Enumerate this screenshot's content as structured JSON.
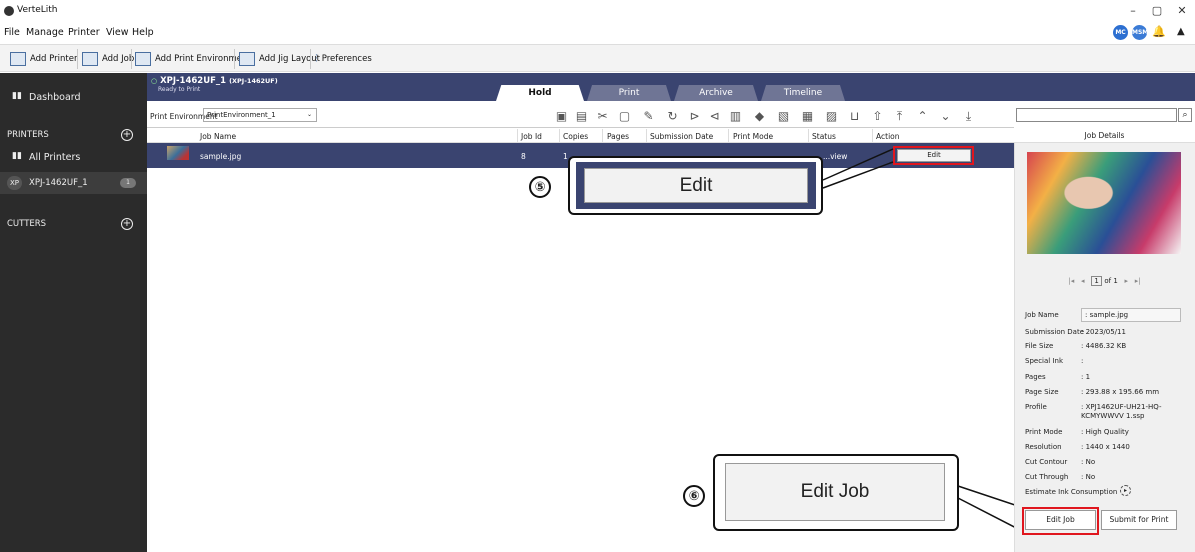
{
  "app": {
    "title": "VerteLith",
    "window_controls": [
      "–",
      "▢",
      "✕"
    ]
  },
  "menu": [
    "File",
    "Manage",
    "Printer",
    "View",
    "Help"
  ],
  "user_badges": [
    "MC",
    "MSM"
  ],
  "toolbar": {
    "add_printer": "Add Printer",
    "add_job": "Add Job",
    "add_print_env": "Add Print Environment",
    "add_jig": "Add Jig Layout",
    "preferences": "Preferences"
  },
  "sidebar": {
    "dashboard": "Dashboard",
    "printers_header": "PRINTERS",
    "all_printers": "All Printers",
    "printer_tag": "XP",
    "printer_item": "XPJ-1462UF_1",
    "printer_count": "1",
    "cutters_header": "CUTTERS"
  },
  "header": {
    "printer_name": "XPJ-1462UF_1",
    "printer_model": "(XPJ-1462UF)",
    "status": "Ready to Print",
    "tabs": [
      "Hold",
      "Print",
      "Archive",
      "Timeline"
    ],
    "active_tab": "Hold"
  },
  "env": {
    "label": "Print Environment",
    "value": "PrintEnvironment_1"
  },
  "columns": [
    "Job Name",
    "Job Id",
    "Copies",
    "Pages",
    "Submission Date",
    "Print Mode",
    "Status",
    "Action"
  ],
  "rows": [
    {
      "job_name": "sample.jpg",
      "job_id": "8",
      "copies": "1",
      "status_partial": "...view",
      "action": "Edit"
    }
  ],
  "callouts": {
    "step5": "⑤",
    "step5_label": "Edit",
    "step6": "⑥",
    "step6_label": "Edit Job"
  },
  "details": {
    "header": "Job Details",
    "pager": {
      "page": "1",
      "of": "of 1"
    },
    "fields": [
      {
        "label": "Job Name",
        "value": ": sample.jpg"
      },
      {
        "label": "Submission Date",
        "value": ": 2023/05/11"
      },
      {
        "label": "File Size",
        "value": ": 4486.32 KB"
      },
      {
        "label": "Special Ink",
        "value": ":"
      },
      {
        "label": "Pages",
        "value": ": 1"
      },
      {
        "label": "Page Size",
        "value": ": 293.88 x 195.66 mm"
      },
      {
        "label": "Profile",
        "value": ": XPJ1462UF-UH21-HQ-KCMYWWVV 1.ssp"
      },
      {
        "label": "Print Mode",
        "value": ": High Quality"
      },
      {
        "label": "Resolution",
        "value": ": 1440 x 1440"
      },
      {
        "label": "Cut Contour",
        "value": ": No"
      },
      {
        "label": "Cut Through",
        "value": ": No"
      }
    ],
    "estimate": "Estimate Ink Consumption",
    "edit_job": "Edit Job",
    "submit": "Submit for Print"
  },
  "colors": {
    "sidebar": "#2b2b2b",
    "header": "#3a4470",
    "highlight": "#e0161e"
  }
}
